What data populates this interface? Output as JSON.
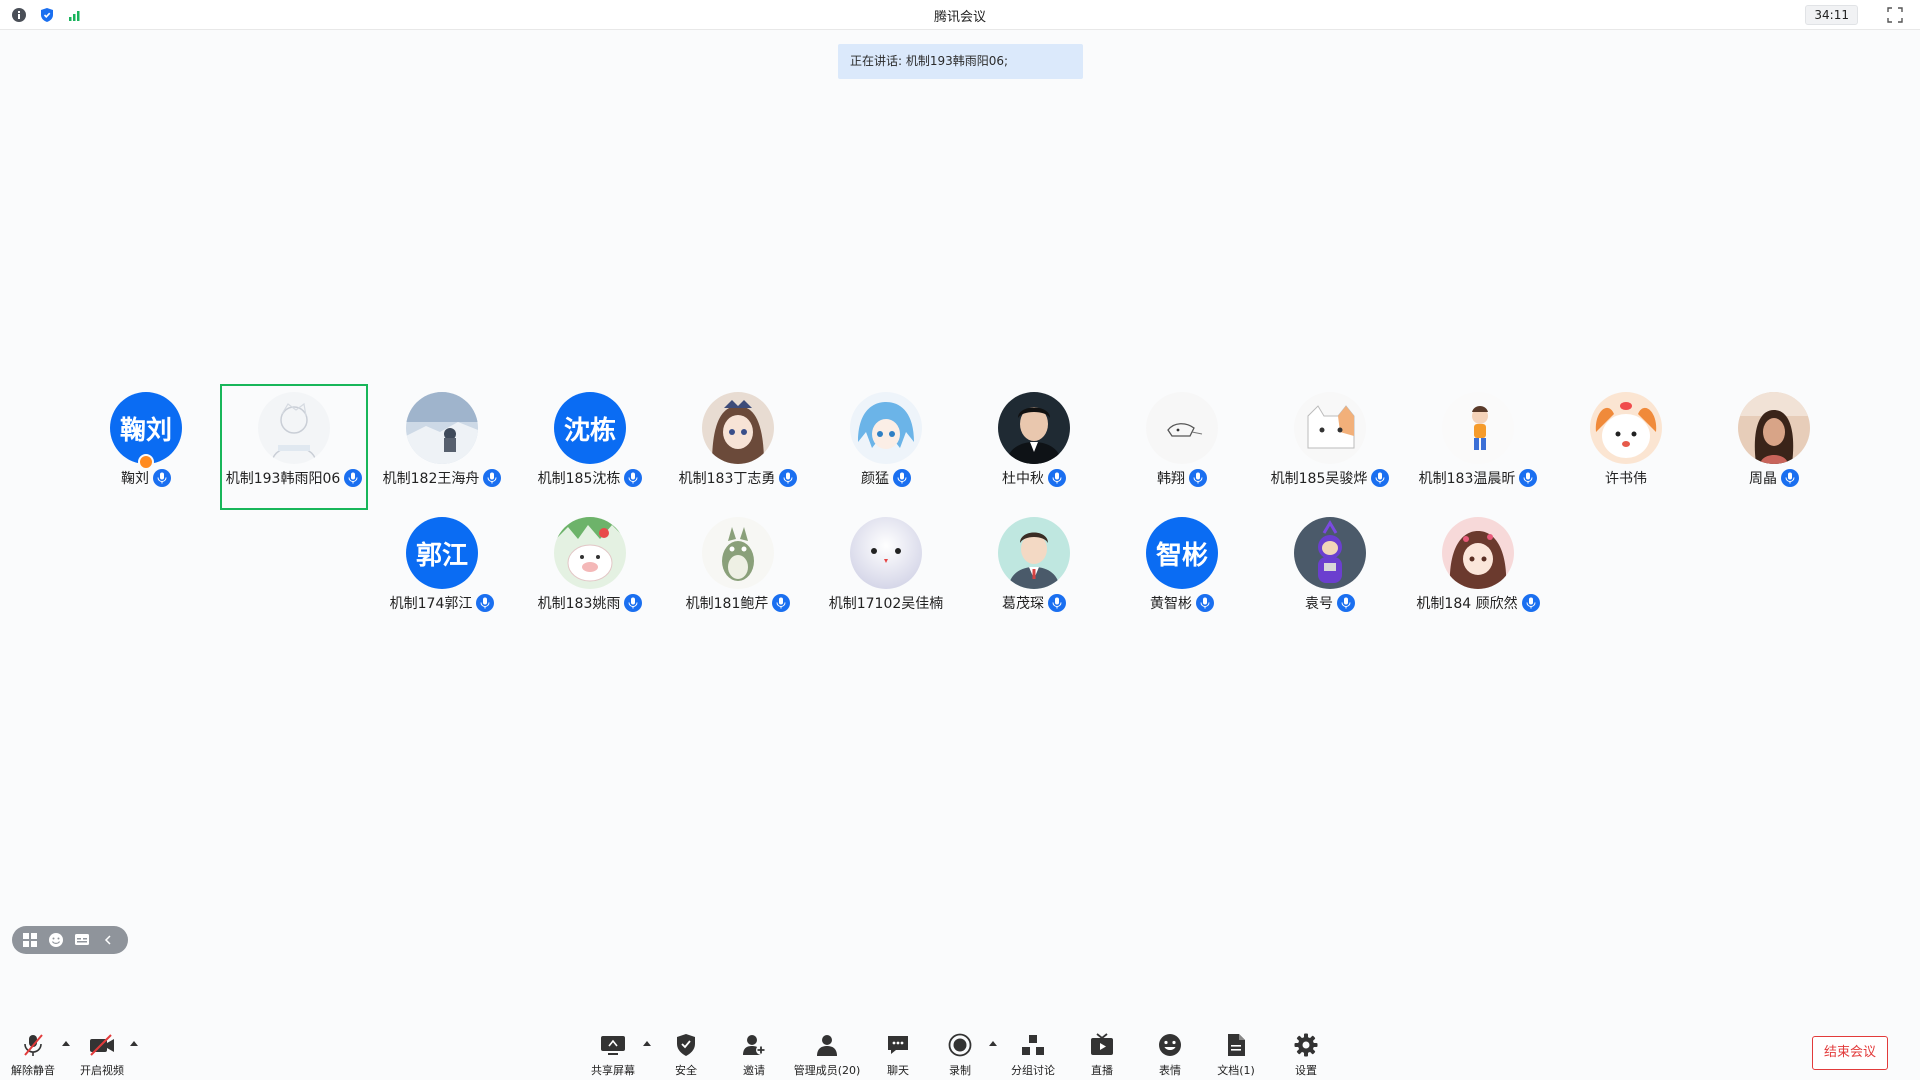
{
  "window": {
    "title": "腾讯会议",
    "timer": "34:11",
    "icons": [
      "info-icon",
      "shield-icon",
      "signal-icon"
    ]
  },
  "speaking": {
    "text": "正在讲话: 机制193韩雨阳06;"
  },
  "participants": [
    {
      "name": "鞠刘",
      "avatar_text": "鞠刘",
      "host": true
    },
    {
      "name": "机制193韩雨阳06",
      "avatar_icon": "sketch-portrait-avatar",
      "active": true
    },
    {
      "name": "机制182王海舟",
      "avatar_icon": "snow-landscape-avatar"
    },
    {
      "name": "机制185沈栋",
      "avatar_text": "沈栋"
    },
    {
      "name": "机制183丁志勇",
      "avatar_icon": "anime-girl-avatar"
    },
    {
      "name": "颜猛",
      "avatar_icon": "blue-hair-anime-avatar"
    },
    {
      "name": "杜中秋",
      "avatar_icon": "man-portrait-avatar"
    },
    {
      "name": "韩翔",
      "avatar_icon": "sketch-avatar"
    },
    {
      "name": "机制185吴骏烨",
      "avatar_icon": "cat-avatar"
    },
    {
      "name": "机制183温晨昕",
      "avatar_icon": "child-cartoon-avatar"
    },
    {
      "name": "许书伟",
      "avatar_icon": "puppy-cartoon-avatar"
    },
    {
      "name": "周晶",
      "avatar_icon": "woman-photo-avatar"
    },
    {
      "name": "机制174郭江",
      "avatar_text": "郭江"
    },
    {
      "name": "机制183姚雨",
      "avatar_icon": "pig-cartoon-avatar"
    },
    {
      "name": "机制181鲍芹",
      "avatar_icon": "totoro-avatar"
    },
    {
      "name": "机制17102吴佳楠",
      "avatar_icon": "white-blob-avatar",
      "no_mic": true
    },
    {
      "name": "葛茂琛",
      "avatar_icon": "cartoon-man-avatar"
    },
    {
      "name": "黄智彬",
      "avatar_text": "智彬"
    },
    {
      "name": "袁号",
      "avatar_icon": "teletubby-avatar"
    },
    {
      "name": "机制184 顾欣然",
      "avatar_icon": "girl-cartoon-avatar"
    }
  ],
  "toolbar": {
    "unmute": "解除静音",
    "start_video": "开启视频",
    "share_screen": "共享屏幕",
    "security": "安全",
    "invite": "邀请",
    "manage_members": "管理成员(20)",
    "chat": "聊天",
    "record": "录制",
    "breakout": "分组讨论",
    "live": "直播",
    "reactions": "表情",
    "docs": "文档(1)",
    "settings": "设置",
    "end_meeting": "结束会议"
  },
  "colors": {
    "accent": "#0a6cf3",
    "active_border": "#18b65a",
    "end_red": "#e23b3b",
    "banner_bg": "#dbe9fb"
  }
}
